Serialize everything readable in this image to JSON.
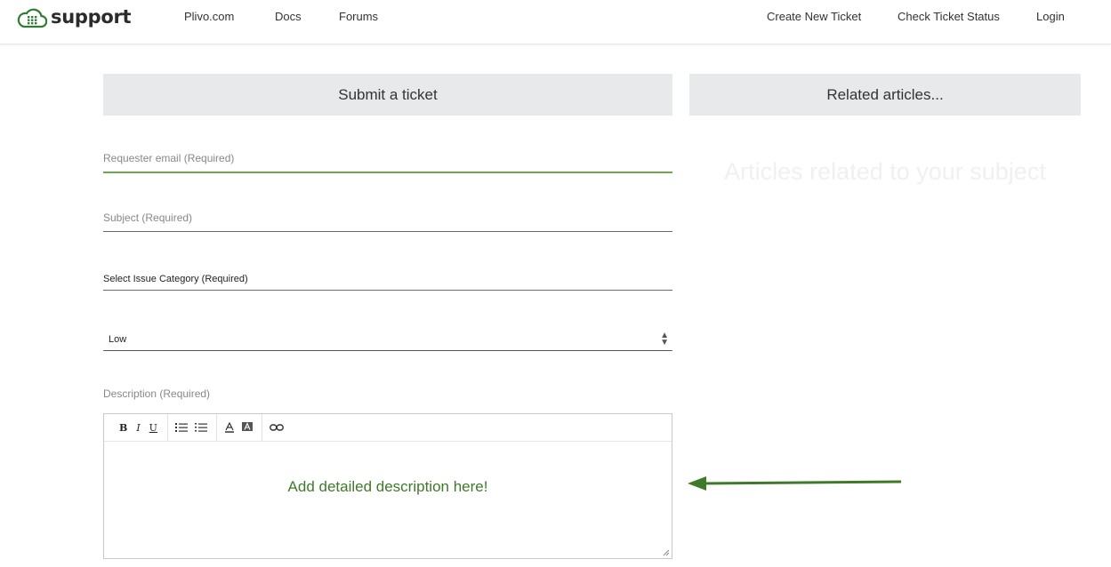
{
  "header": {
    "logo_text": "support",
    "nav_left": [
      "Plivo.com",
      "Docs",
      "Forums"
    ],
    "nav_right": [
      "Create New Ticket",
      "Check Ticket Status",
      "Login"
    ]
  },
  "form": {
    "title": "Submit a ticket",
    "email_placeholder": "Requester email (Required)",
    "subject_placeholder": "Subject (Required)",
    "category_label": "Select Issue Category (Required)",
    "priority_value": "Low",
    "description_label": "Description (Required)",
    "editor_text": "Add detailed description here!",
    "toolbar": {
      "bold": "B",
      "italic": "I",
      "underline": "U",
      "icons": [
        "bulleted-list-icon",
        "numbered-list-icon",
        "text-color-icon",
        "background-color-icon",
        "link-icon"
      ]
    }
  },
  "related": {
    "title": "Related articles...",
    "empty_text": "Articles related to your subject"
  },
  "colors": {
    "accent_green": "#3f7a2a",
    "focus_green": "#6aa84f",
    "panel_gray": "#e8e9ea"
  }
}
